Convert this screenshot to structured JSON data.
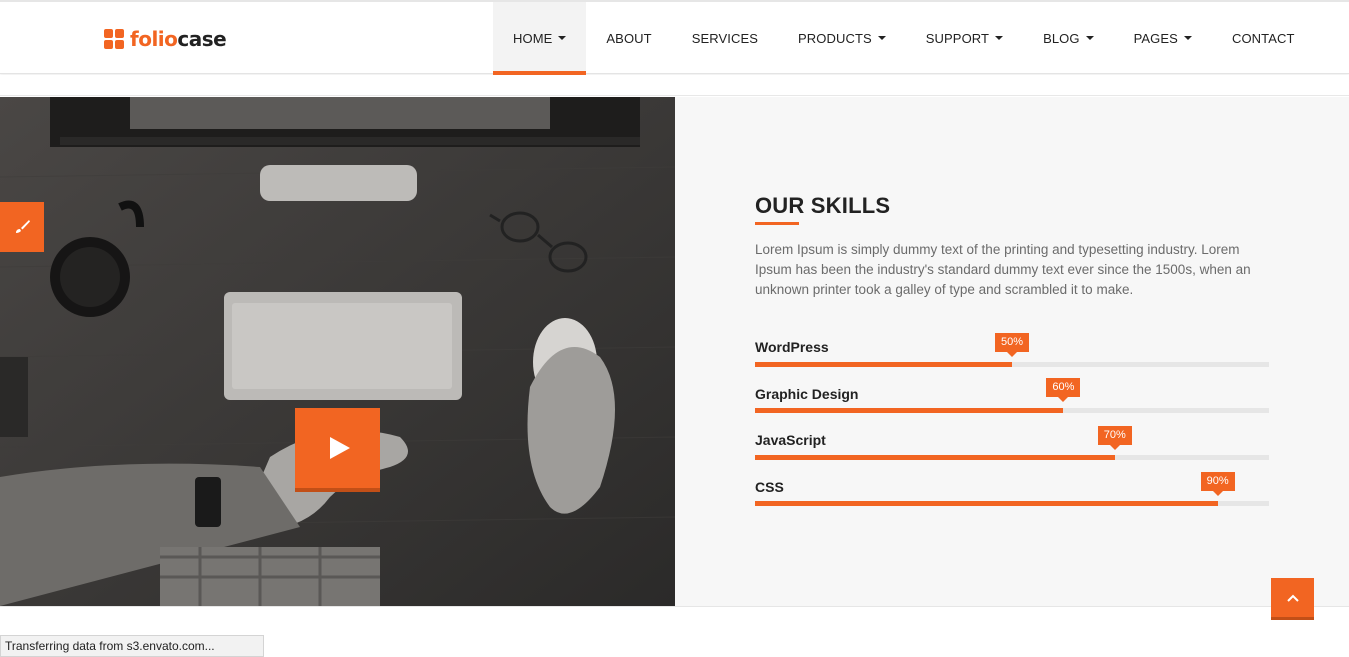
{
  "brand": {
    "logo_part1": "folio",
    "logo_part2": "case",
    "accent": "#f26522"
  },
  "nav": {
    "items": [
      {
        "label": "HOME",
        "dropdown": true,
        "active": true
      },
      {
        "label": "ABOUT",
        "dropdown": false
      },
      {
        "label": "SERVICES",
        "dropdown": false
      },
      {
        "label": "PRODUCTS",
        "dropdown": true
      },
      {
        "label": "SUPPORT",
        "dropdown": true
      },
      {
        "label": "BLOG",
        "dropdown": true
      },
      {
        "label": "PAGES",
        "dropdown": true
      },
      {
        "label": "CONTACT",
        "dropdown": false
      }
    ]
  },
  "hero": {
    "play_icon": "play-icon",
    "paint_icon": "paintbrush-icon"
  },
  "skills": {
    "title": "OUR SKILLS",
    "description": "Lorem Ipsum is simply dummy text of the printing and typesetting industry. Lorem Ipsum has been the industry's standard dummy text ever since the 1500s, when an unknown printer took a galley of type and scrambled it to make.",
    "items": [
      {
        "name": "WordPress",
        "percent_label": "50%",
        "value": 0.5
      },
      {
        "name": "Graphic Design",
        "percent_label": "60%",
        "value": 0.6
      },
      {
        "name": "JavaScript",
        "percent_label": "70%",
        "value": 0.7
      },
      {
        "name": "CSS",
        "percent_label": "90%",
        "value": 0.9
      }
    ]
  },
  "back_to_top": {
    "icon": "chevron-up-icon"
  },
  "status": {
    "text": "Transferring data from s3.envato.com..."
  }
}
